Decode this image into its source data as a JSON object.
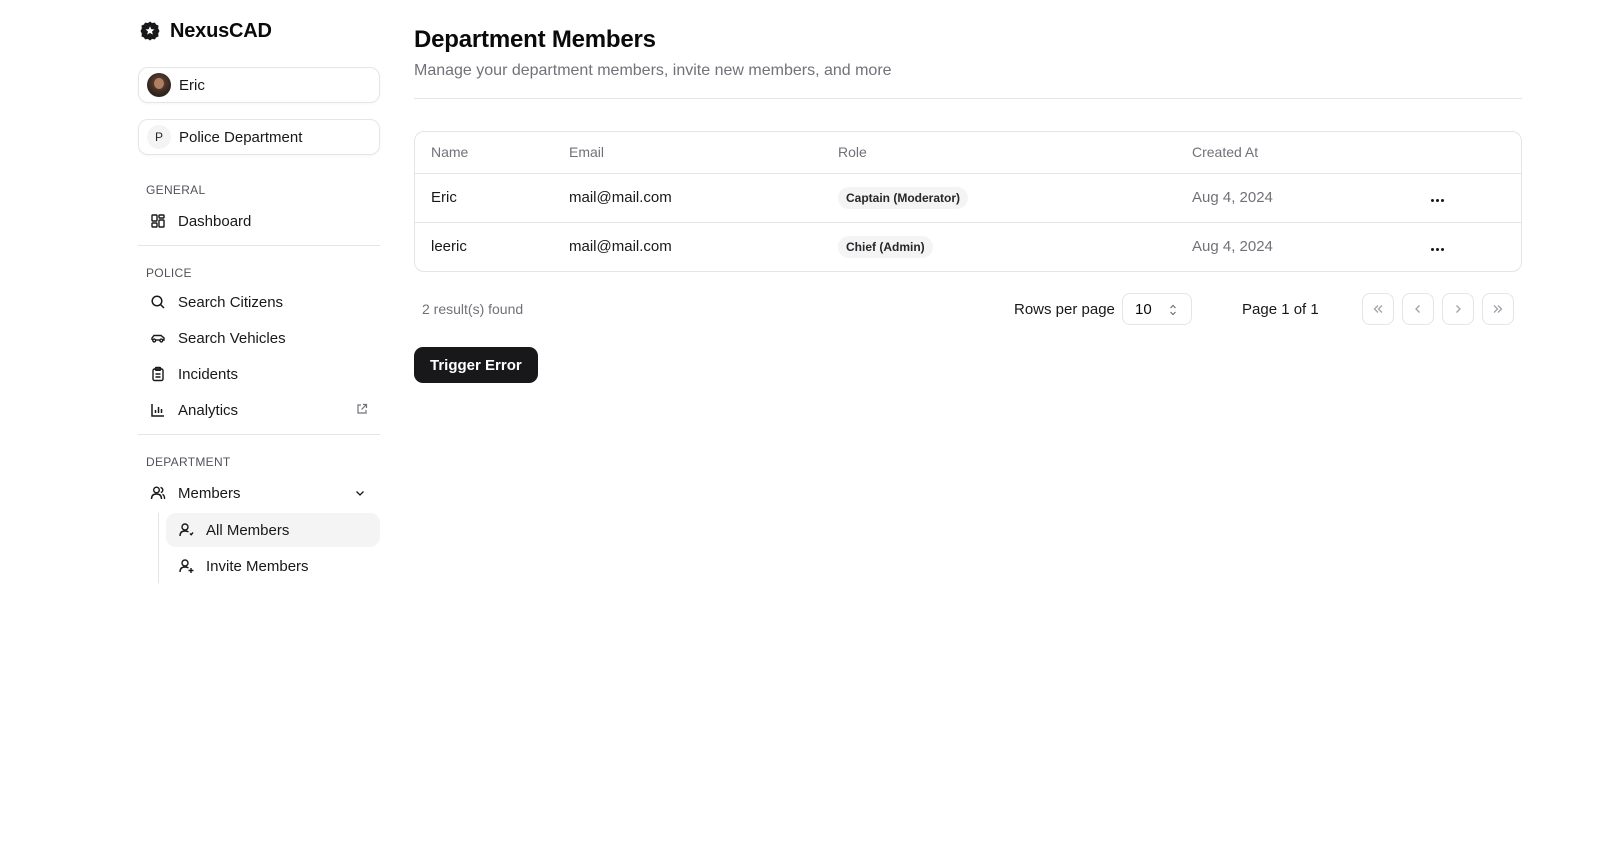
{
  "brand": {
    "name": "NexusCAD",
    "icon": "badge-star-icon"
  },
  "user_picker": {
    "name": "Eric"
  },
  "dept_picker": {
    "initial": "P",
    "name": "Police Department"
  },
  "sidebar": {
    "general": {
      "label": "GENERAL",
      "items": [
        {
          "label": "Dashboard",
          "icon": "dashboard-icon"
        }
      ]
    },
    "police": {
      "label": "POLICE",
      "items": [
        {
          "label": "Search Citizens",
          "icon": "search-icon"
        },
        {
          "label": "Search Vehicles",
          "icon": "car-icon"
        },
        {
          "label": "Incidents",
          "icon": "clipboard-icon"
        },
        {
          "label": "Analytics",
          "icon": "chart-icon"
        }
      ]
    },
    "department": {
      "label": "DEPARTMENT",
      "members": {
        "label": "Members",
        "icon": "users-icon"
      },
      "sub_items": [
        {
          "label": "All Members",
          "icon": "user-icon",
          "active": true
        },
        {
          "label": "Invite Members",
          "icon": "user-plus-icon"
        }
      ]
    }
  },
  "page": {
    "title": "Department Members",
    "subtitle": "Manage your department members, invite new members, and more"
  },
  "table": {
    "columns": [
      "Name",
      "Email",
      "Role",
      "Created At"
    ],
    "rows": [
      {
        "name": "Eric",
        "email": "mail@mail.com",
        "role": "Captain (Moderator)",
        "created": "Aug 4, 2024"
      },
      {
        "name": "leeric",
        "email": "mail@mail.com",
        "role": "Chief (Admin)",
        "created": "Aug 4, 2024"
      }
    ]
  },
  "footer": {
    "results": "2 result(s) found",
    "rows_per_page_label": "Rows per page",
    "rows_per_page_value": "10",
    "page_info": "Page 1 of 1"
  },
  "trigger_button": {
    "label": "Trigger Error"
  },
  "colors": {
    "primary": "#18181b",
    "muted": "#71717a",
    "border": "#e5e5e5",
    "accent_bg": "#f4f4f5"
  }
}
